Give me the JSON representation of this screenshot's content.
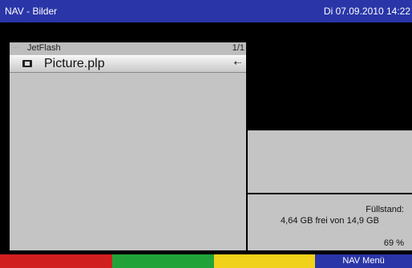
{
  "header": {
    "title": "NAV - Bilder",
    "datetime": "Di 07.09.2010 14:22"
  },
  "browser": {
    "path_label": "JetFlash",
    "page_indicator": "1/1",
    "files": [
      {
        "name": "Picture.plp",
        "icon": "picture-file-icon",
        "source_icon": "usb-icon"
      }
    ]
  },
  "status": {
    "title": "Füllstand:",
    "free_text": "4,64 GB frei von 14,9 GB",
    "percent_text": "69 %",
    "percent": 69
  },
  "softkeys": {
    "red": "",
    "green": "",
    "yellow": "",
    "blue": "NAV Menü"
  },
  "colors": {
    "title_bar": "#2a36a8",
    "panel_bg": "#c4c4c4",
    "red": "#d11f1f",
    "green": "#22a33a",
    "yellow": "#f0d21a",
    "blue": "#2a36a8"
  }
}
